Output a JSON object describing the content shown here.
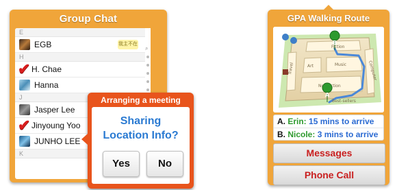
{
  "group_chat": {
    "title": "Group Chat",
    "yellow_tag": "我主不在",
    "scroll_search_icon": "search-icon",
    "contacts": [
      {
        "section": "E"
      },
      {
        "name": "EGB",
        "avatar": "photo",
        "checked": false
      },
      {
        "section": "H"
      },
      {
        "name": "H. Chae",
        "avatar": "check",
        "checked": true
      },
      {
        "name": "Hanna",
        "avatar": "photo",
        "checked": false
      },
      {
        "section": "J"
      },
      {
        "name": "Jasper Lee",
        "avatar": "photo",
        "checked": false
      },
      {
        "name": "Jinyoung Yoo",
        "avatar": "check",
        "checked": true
      },
      {
        "name": "JUNHO LEE",
        "avatar": "photo",
        "checked": false
      },
      {
        "section": "K"
      }
    ]
  },
  "meeting_popup": {
    "title": "Arranging a meeting",
    "question_line1": "Sharing",
    "question_line2": "Location Info?",
    "yes_label": "Yes",
    "no_label": "No"
  },
  "walking_route": {
    "title": "GPA Walking Route",
    "map_labels": {
      "fiction": "Fiction",
      "art": "Art",
      "music": "Music",
      "nonfiction": "Non-fiction",
      "bestsellers": "Best-sellers",
      "travel": "Travel",
      "computer": "Computer"
    },
    "markers": {
      "start": "B",
      "end": "A"
    },
    "arrivals": [
      {
        "letter": "A.",
        "name": "Erin:",
        "time": "15 mins to arrive"
      },
      {
        "letter": "B.",
        "name": "Nicole:",
        "time": "3 mins to arrive"
      }
    ],
    "messages_label": "Messages",
    "phone_call_label": "Phone Call"
  },
  "colors": {
    "panel_orange": "#f0a53a",
    "popup_orange": "#e8541c",
    "question_blue": "#2a7ad2",
    "check_red": "#d81e1e",
    "name_green": "#2e9a2e",
    "button_red": "#c92020"
  }
}
